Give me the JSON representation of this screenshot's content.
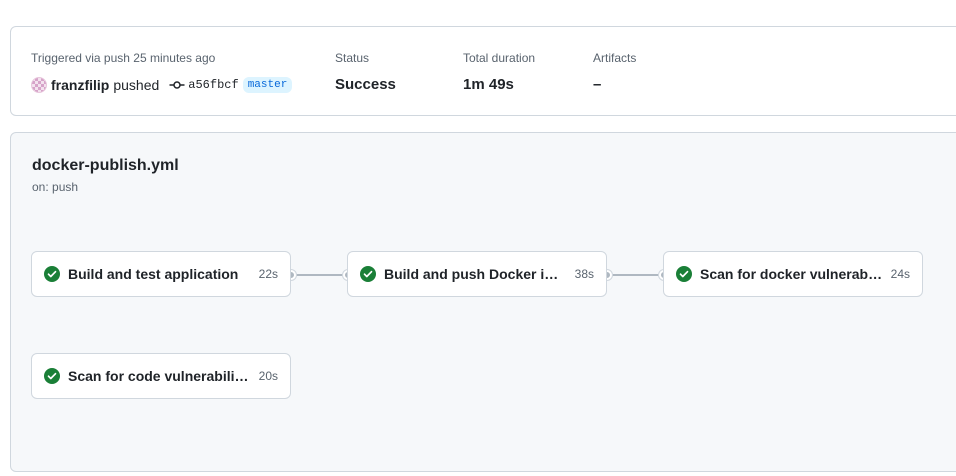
{
  "summary": {
    "trigger_text": "Triggered via push 25 minutes ago",
    "actor": "franzfilip",
    "action": "pushed",
    "commit_sha": "a56fbcf",
    "branch": "master",
    "status_label": "Status",
    "status_value": "Success",
    "duration_label": "Total duration",
    "duration_value": "1m 49s",
    "artifacts_label": "Artifacts",
    "artifacts_value": "–"
  },
  "workflow": {
    "file": "docker-publish.yml",
    "trigger": "on: push",
    "jobs": [
      {
        "name": "Build and test application",
        "duration": "22s",
        "status": "success"
      },
      {
        "name": "Build and push Docker image",
        "duration": "38s",
        "status": "success"
      },
      {
        "name": "Scan for docker vulnerabilit...",
        "duration": "24s",
        "status": "success"
      },
      {
        "name": "Scan for code vulnerabilities",
        "duration": "20s",
        "status": "success"
      }
    ]
  },
  "icons": {
    "success": "check-circle-fill-icon",
    "commit": "git-commit-icon",
    "avatar": "avatar"
  },
  "colors": {
    "success": "#1a7f37",
    "branch_text": "#0969da",
    "branch_bg": "#ddf4ff",
    "connector": "#afb8c1"
  }
}
